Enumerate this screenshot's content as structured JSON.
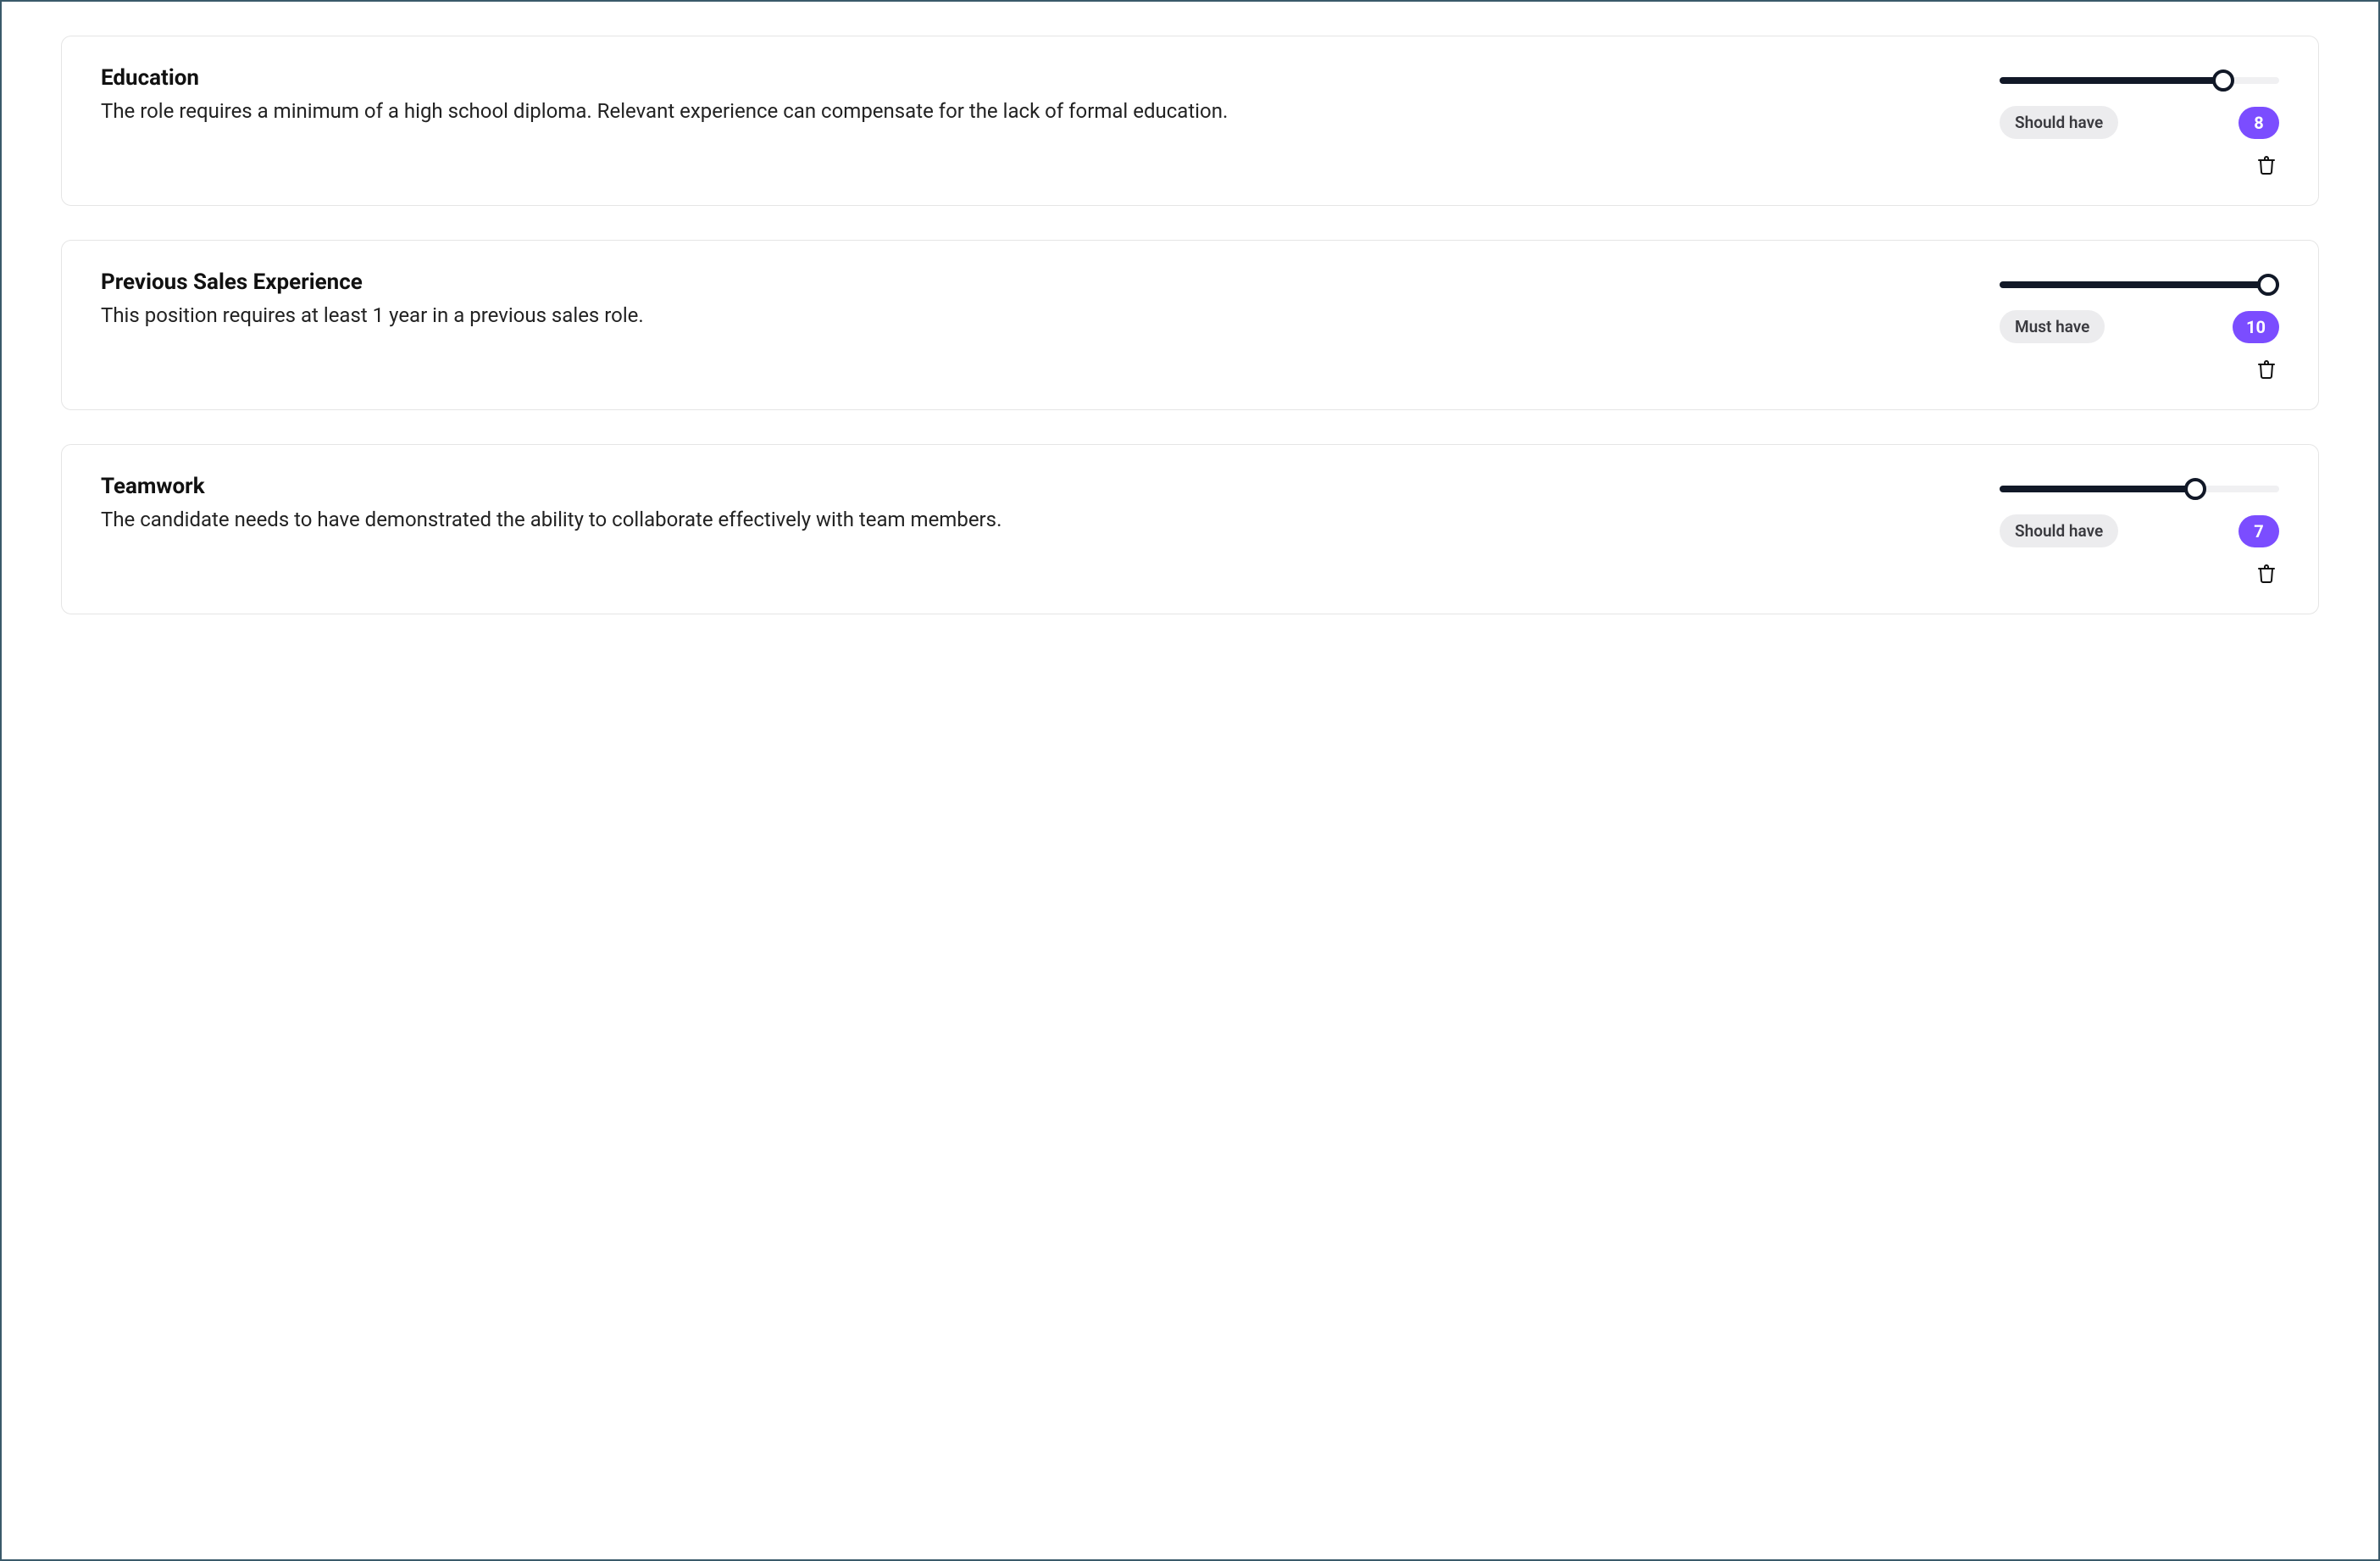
{
  "slider_max": 10,
  "criteria": [
    {
      "title": "Education",
      "description": "The role requires a minimum of a high school diploma. Relevant experience can compensate for the lack of formal education.",
      "priority_label": "Should have",
      "score": 8
    },
    {
      "title": "Previous Sales Experience",
      "description": "This position requires at least 1 year in a previous sales role.",
      "priority_label": "Must have",
      "score": 10
    },
    {
      "title": "Teamwork",
      "description": "The candidate needs to have demonstrated the ability to collaborate effectively with team members.",
      "priority_label": "Should have",
      "score": 7
    }
  ]
}
